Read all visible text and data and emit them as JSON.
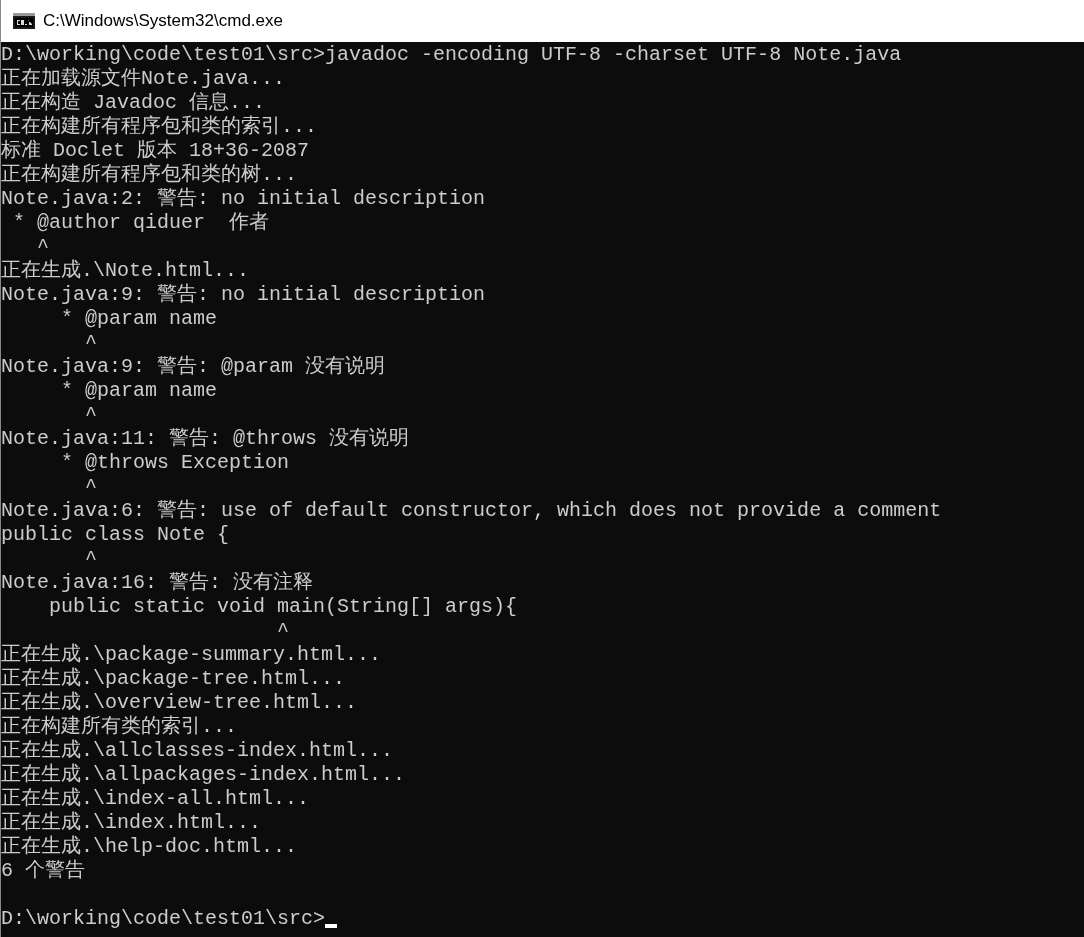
{
  "window": {
    "title": "C:\\Windows\\System32\\cmd.exe"
  },
  "console": {
    "lines": [
      {
        "text": "D:\\working\\code\\test01\\src>javadoc -encoding UTF-8 -charset UTF-8 Note.java"
      },
      {
        "text": "正在加载源文件Note.java..."
      },
      {
        "text": "正在构造 Javadoc 信息..."
      },
      {
        "text": "正在构建所有程序包和类的索引..."
      },
      {
        "text": "标准 Doclet 版本 18+36-2087"
      },
      {
        "text": "正在构建所有程序包和类的树..."
      },
      {
        "text": "Note.java:2: 警告: no initial description"
      },
      {
        "text": " * @author qiduer  作者"
      },
      {
        "text": "   ^"
      },
      {
        "text": "正在生成.\\Note.html..."
      },
      {
        "text": "Note.java:9: 警告: no initial description"
      },
      {
        "text": "     * @param name"
      },
      {
        "text": "       ^"
      },
      {
        "text": "Note.java:9: 警告: @param 没有说明"
      },
      {
        "text": "     * @param name"
      },
      {
        "text": "       ^"
      },
      {
        "text": "Note.java:11: 警告: @throws 没有说明"
      },
      {
        "text": "     * @throws Exception"
      },
      {
        "text": "       ^"
      },
      {
        "text": "Note.java:6: 警告: use of default constructor, which does not provide a comment"
      },
      {
        "text": "public class Note {"
      },
      {
        "text": "       ^"
      },
      {
        "text": "Note.java:16: 警告: 没有注释"
      },
      {
        "text": "    public static void main(String[] args){"
      },
      {
        "text": "                       ^"
      },
      {
        "text": "正在生成.\\package-summary.html..."
      },
      {
        "text": "正在生成.\\package-tree.html..."
      },
      {
        "text": "正在生成.\\overview-tree.html..."
      },
      {
        "text": "正在构建所有类的索引..."
      },
      {
        "text": "正在生成.\\allclasses-index.html..."
      },
      {
        "text": "正在生成.\\allpackages-index.html..."
      },
      {
        "text": "正在生成.\\index-all.html..."
      },
      {
        "text": "正在生成.\\index.html..."
      },
      {
        "text": "正在生成.\\help-doc.html..."
      },
      {
        "text": "6 个警告"
      }
    ],
    "prompt": {
      "text": "D:\\working\\code\\test01\\src>",
      "cursor": true
    }
  }
}
